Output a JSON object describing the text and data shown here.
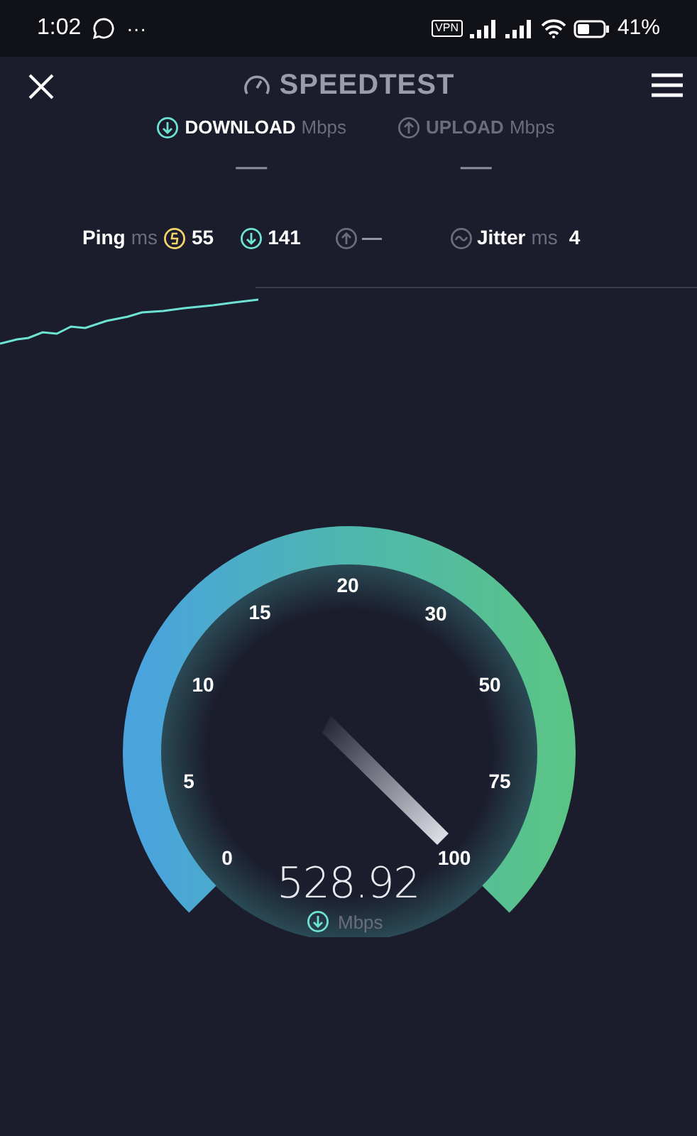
{
  "status_bar": {
    "time": "1:02",
    "more": "···",
    "vpn": "VPN",
    "battery": "41%"
  },
  "app_title": "SPEEDTEST",
  "tabs": [
    {
      "label": "DOWNLOAD",
      "unit": "Mbps",
      "value": "—",
      "selected": true
    },
    {
      "label": "UPLOAD",
      "unit": "Mbps",
      "value": "—",
      "selected": false
    }
  ],
  "stats": {
    "ping_label": "Ping",
    "ping_unit": "ms",
    "ping_value": "55",
    "download_value": "141",
    "upload_value": "—",
    "jitter_label": "Jitter",
    "jitter_unit": "ms",
    "jitter_value": "4"
  },
  "gauge": {
    "labels": [
      "0",
      "5",
      "10",
      "15",
      "20",
      "30",
      "50",
      "75",
      "100"
    ],
    "reading": "528.92",
    "unit": "Mbps"
  }
}
